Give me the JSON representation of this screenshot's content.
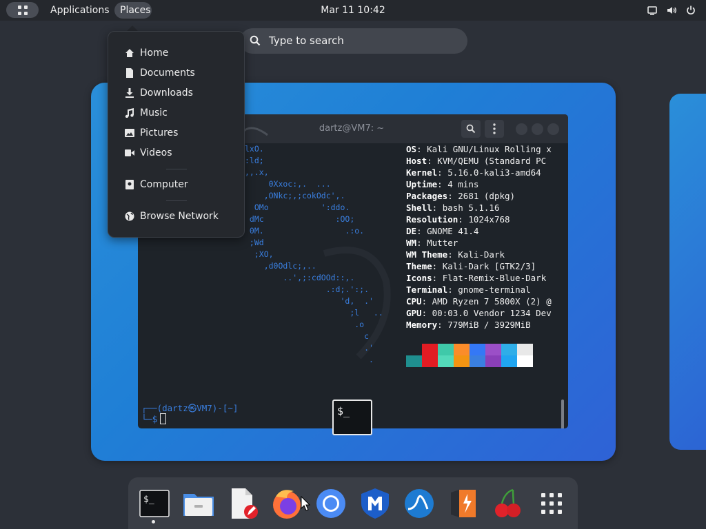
{
  "topbar": {
    "applications": "Applications",
    "places": "Places",
    "clock": "Mar 11  10:42"
  },
  "search": {
    "placeholder": "Type to search"
  },
  "places_menu": {
    "items": [
      {
        "label": "Home",
        "icon": "home-icon"
      },
      {
        "label": "Documents",
        "icon": "document-icon"
      },
      {
        "label": "Downloads",
        "icon": "download-icon"
      },
      {
        "label": "Music",
        "icon": "music-icon"
      },
      {
        "label": "Pictures",
        "icon": "picture-icon"
      },
      {
        "label": "Videos",
        "icon": "video-icon"
      }
    ],
    "computer": "Computer",
    "network": "Browse Network"
  },
  "terminal": {
    "title": "dartz@VM7: ~",
    "ascii": [
      "lxO.",
      ":ld;",
      ",,.x,",
      "     0Xxoc:,.  ...",
      "    ,ONkc;,;cokOdc',.",
      "  OMo           ':ddo.",
      " dMc               :OO;",
      " 0M.                 .:o.",
      " ;Wd",
      "  ;XO,",
      "    ,d0Odlc;,..",
      "        ..',;:cdOOd::,.",
      "                 .:d;.':;.",
      "                    'd,  .'",
      "                      ;l   ..",
      "                       .o",
      "                         c",
      "                         .'",
      "                          ."
    ],
    "info": [
      {
        "key": "OS",
        "value": "Kali GNU/Linux Rolling x"
      },
      {
        "key": "Host",
        "value": "KVM/QEMU (Standard PC"
      },
      {
        "key": "Kernel",
        "value": "5.16.0-kali3-amd64"
      },
      {
        "key": "Uptime",
        "value": "4 mins"
      },
      {
        "key": "Packages",
        "value": "2681 (dpkg)"
      },
      {
        "key": "Shell",
        "value": "bash 5.1.16"
      },
      {
        "key": "Resolution",
        "value": "1024x768"
      },
      {
        "key": "DE",
        "value": "GNOME 41.4"
      },
      {
        "key": "WM",
        "value": "Mutter"
      },
      {
        "key": "WM Theme",
        "value": "Kali-Dark"
      },
      {
        "key": "Theme",
        "value": "Kali-Dark [GTK2/3]"
      },
      {
        "key": "Icons",
        "value": "Flat-Remix-Blue-Dark"
      },
      {
        "key": "Terminal",
        "value": "gnome-terminal"
      },
      {
        "key": "CPU",
        "value": "AMD Ryzen 7 5800X (2) @"
      },
      {
        "key": "GPU",
        "value": "00:03.0 Vendor 1234 Dev"
      },
      {
        "key": "Memory",
        "value": "779MiB / 3929MiB"
      }
    ],
    "palette_top": [
      "#1e2329",
      "#e21c23",
      "#3fc9a9",
      "#fb8c2a",
      "#3478f6",
      "#9b4fc7",
      "#2faee8",
      "#e8e8e8"
    ],
    "palette_bottom": [
      "#1f8f8f",
      "#e21c23",
      "#53d9b9",
      "#f39412",
      "#3a7fe0",
      "#8a3fb8",
      "#20a5f0",
      "#ffffff"
    ],
    "prompt_line": "(dartz㉿VM7)-[~]",
    "prompt_symbol": "$",
    "badge": "$_"
  },
  "dock": {
    "apps": [
      "terminal-icon",
      "files-icon",
      "text-editor-icon",
      "firefox-icon",
      "chromium-icon",
      "metasploit-icon",
      "wireshark-icon",
      "burpsuite-icon",
      "cherrytree-icon",
      "app-grid-icon"
    ]
  },
  "colors": {
    "accent": "#2a8fd9",
    "kali_blue": "#3a7fe0",
    "panel": "#25282d"
  }
}
